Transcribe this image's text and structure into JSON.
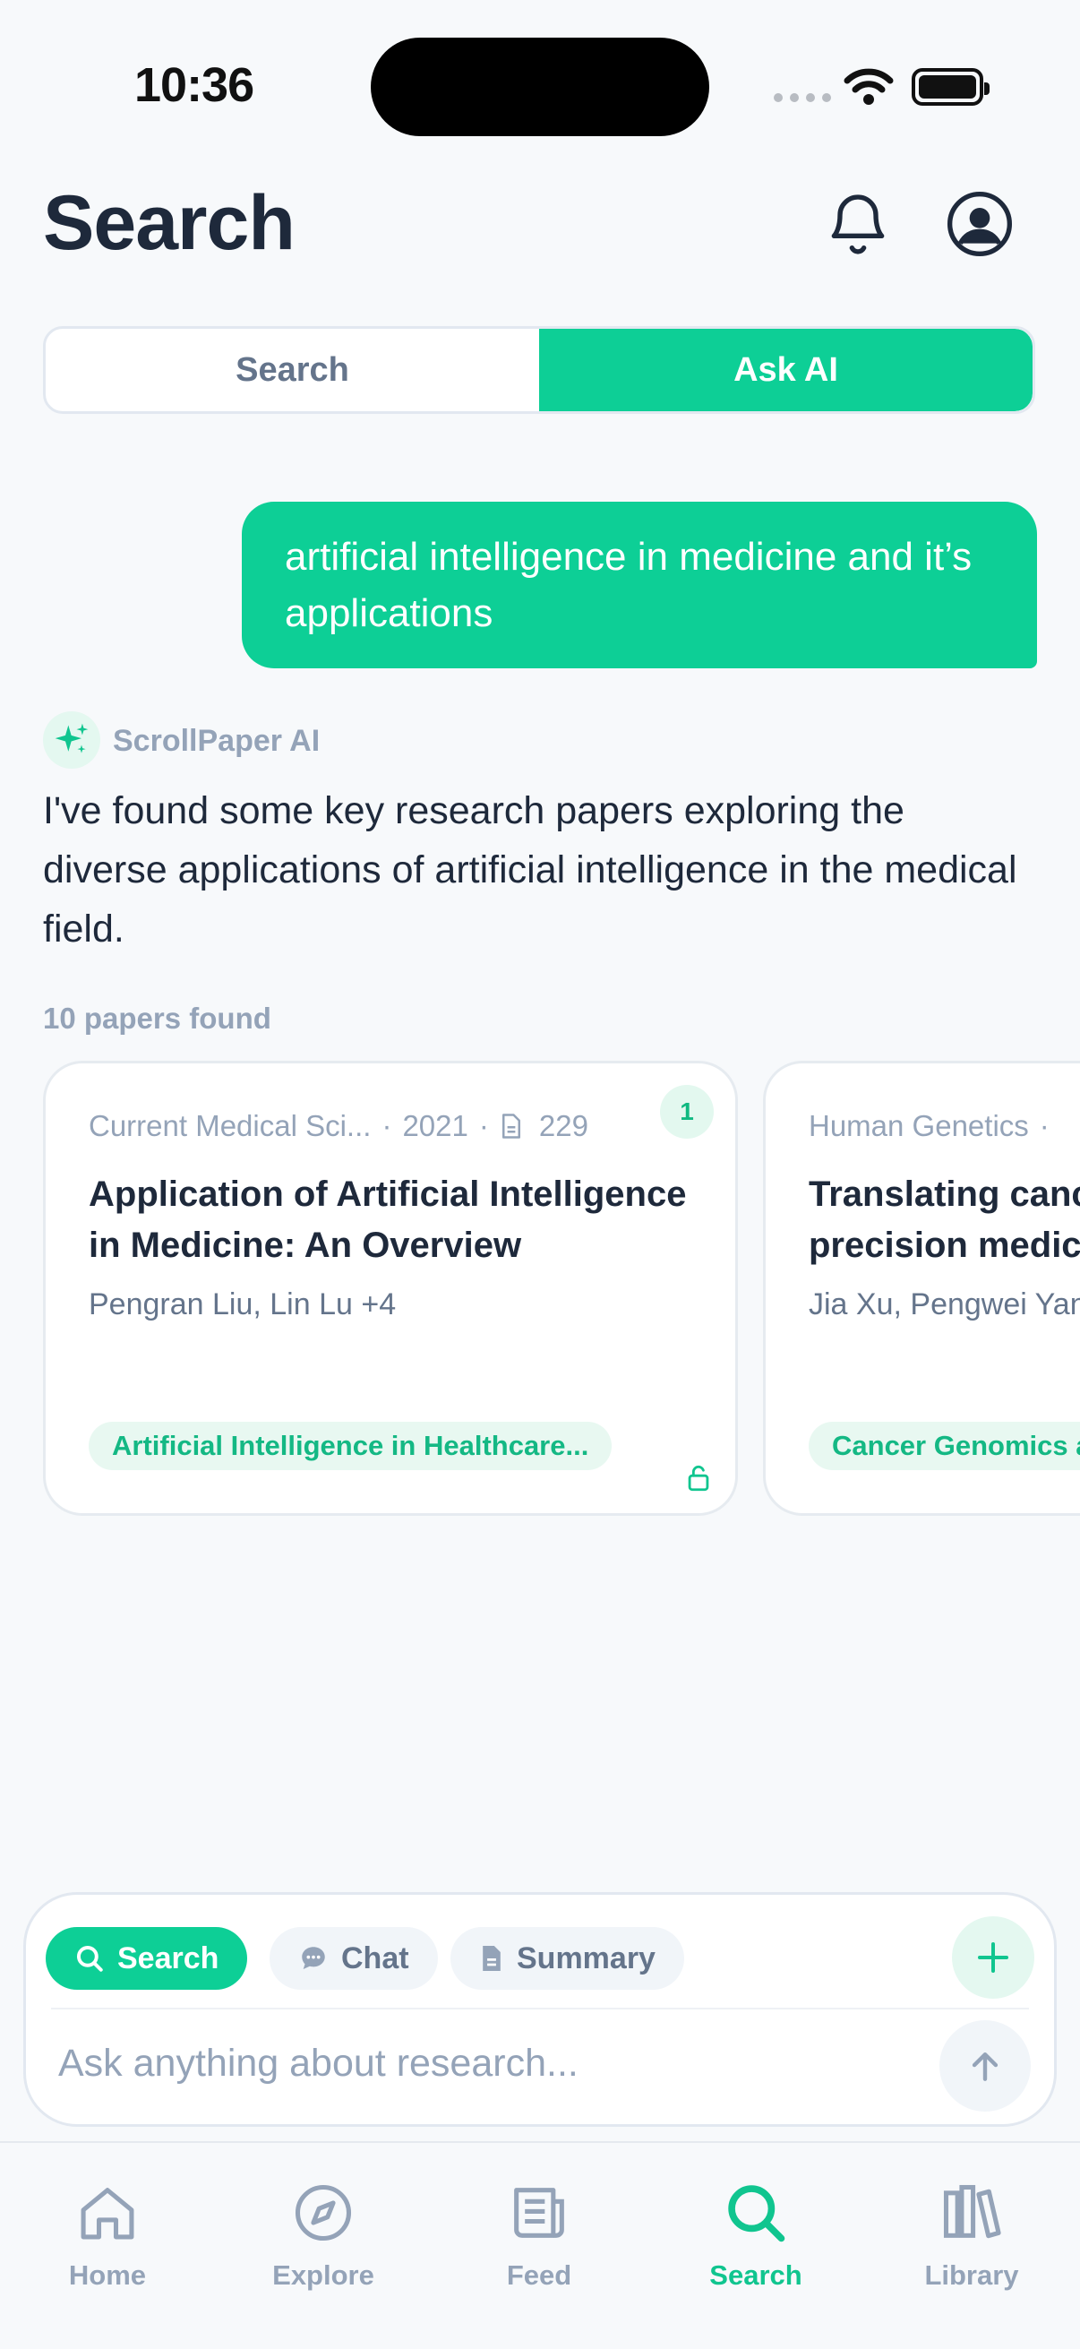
{
  "status_bar": {
    "time": "10:36"
  },
  "header": {
    "title": "Search"
  },
  "segments": {
    "search": "Search",
    "ask_ai": "Ask AI",
    "active": "ask_ai"
  },
  "conversation": {
    "user_message": "artificial intelligence in medicine and it’s applications",
    "ai_name": "ScrollPaper AI",
    "ai_message": "I've found some key research papers exploring the diverse applications of artificial intelligence in the medical field.",
    "papers_found": "10 papers found"
  },
  "papers": [
    {
      "rank": "1",
      "journal": "Current Medical Sci...",
      "year": "2021",
      "citations": "229",
      "title": "Application of Artificial Intelligence in Medicine: An Overview",
      "authors": "Pengran Liu, Lin Lu +4",
      "tag": "Artificial Intelligence in Healthcare..."
    },
    {
      "journal": "Human Genetics",
      "title_line1": "Translating cancer genomics into",
      "title_line2": "precision medicine",
      "authors": "Jia Xu, Pengwei Yang",
      "tag": "Cancer Genomics and"
    }
  ],
  "composer": {
    "chips": {
      "search": "Search",
      "chat": "Chat",
      "summary": "Summary"
    },
    "placeholder": "Ask anything about research..."
  },
  "tabbar": {
    "items": [
      {
        "label": "Home",
        "icon": "home-icon"
      },
      {
        "label": "Explore",
        "icon": "compass-icon"
      },
      {
        "label": "Feed",
        "icon": "newspaper-icon"
      },
      {
        "label": "Search",
        "icon": "search-icon"
      },
      {
        "label": "Library",
        "icon": "library-icon"
      }
    ],
    "active": "Search"
  },
  "colors": {
    "accent": "#0dcf96",
    "text": "#1e293b",
    "muted": "#94a3b8"
  }
}
